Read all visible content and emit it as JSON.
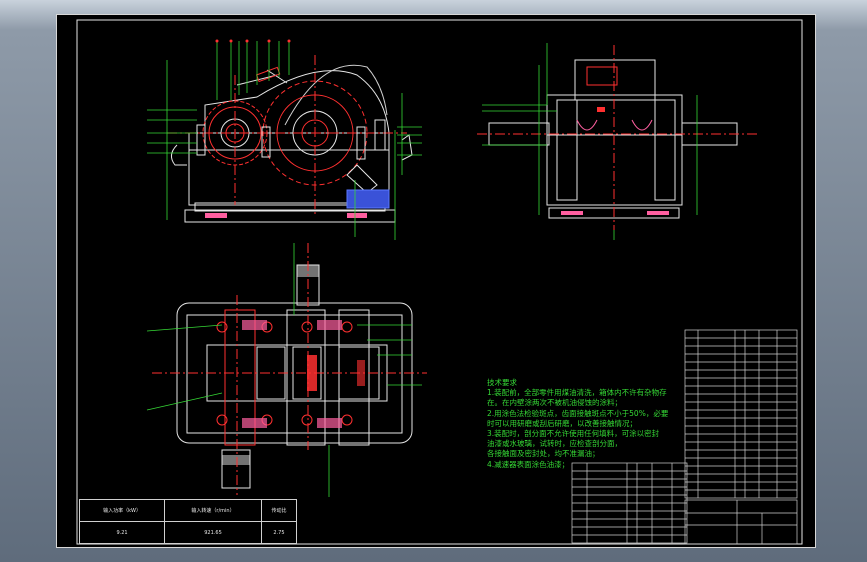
{
  "technical_requirements": {
    "title": "技术要求",
    "lines": [
      "1.装配前，全部零件用煤油清洗，箱体内不许有杂物存",
      "在。在内壁涂两次不被机油侵蚀的涂料；",
      "2.用涂色法检验斑点，齿面接触斑点不小于50%，必要",
      "时可以用研磨或刮后研磨，以改善接触情况；",
      "3.装配时，剖分面不允许使用任何填料，可涂以密封",
      "油漆或水玻璃，试转时，应检查剖分面，",
      "各接触面及密封处，均不准漏油；",
      "4.减速器表面涂色油漆；"
    ]
  },
  "performance_table": {
    "headers": [
      "输入功率（kW）",
      "输入转速（r/min）",
      "传动比"
    ],
    "values": [
      "9.21",
      "921.65",
      "2.75"
    ]
  }
}
